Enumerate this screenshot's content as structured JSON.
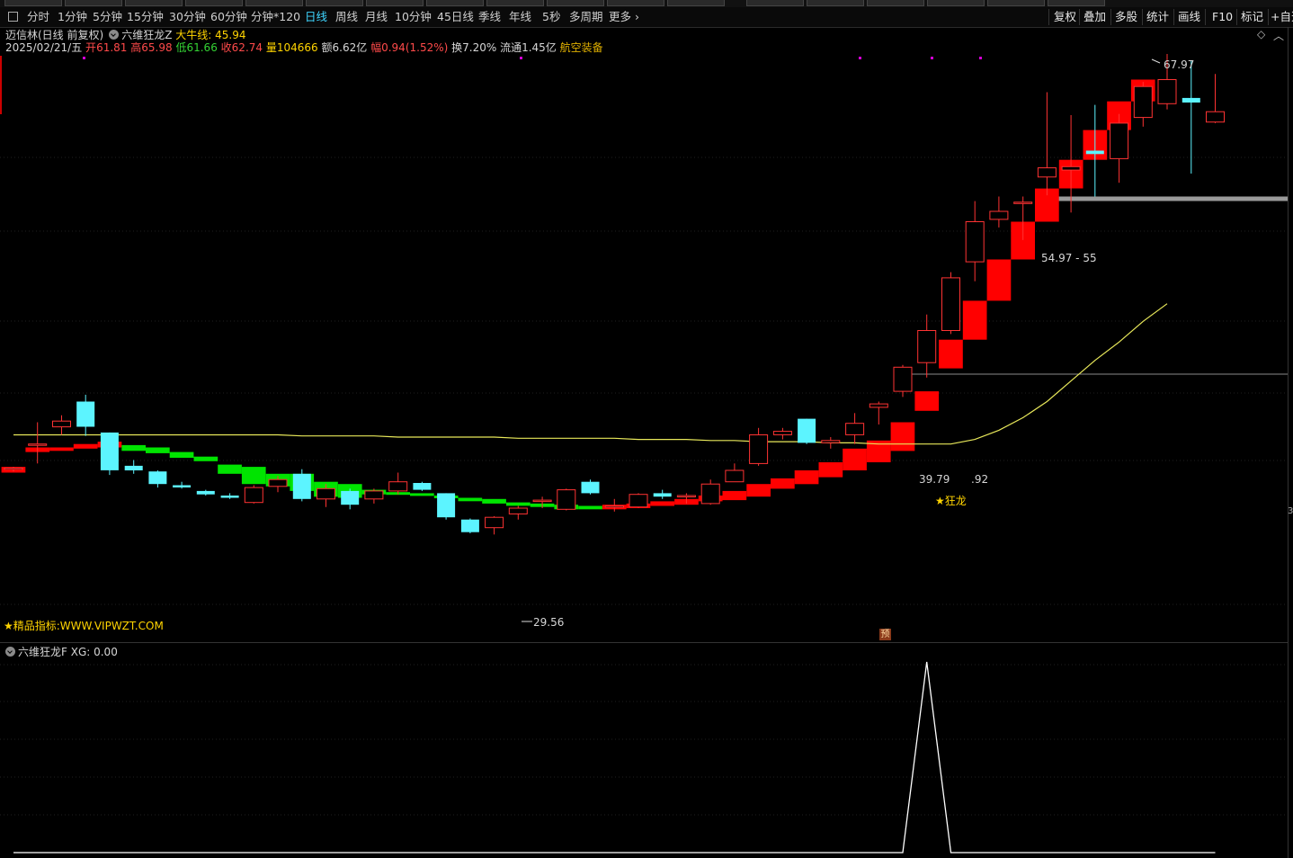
{
  "toolbar": {
    "periods": [
      "分时",
      "1分钟",
      "5分钟",
      "15分钟",
      "30分钟",
      "60分钟",
      "分钟*120",
      "日线",
      "周线",
      "月线",
      "10分钟",
      "45日线",
      "季线",
      "年线",
      "5秒",
      "多周期",
      "更多"
    ],
    "active_period": "日线",
    "right_buttons": [
      "复权",
      "叠加",
      "多股",
      "统计",
      "画线",
      "F10",
      "标记",
      "+自选"
    ]
  },
  "header": {
    "stock": "迈信林(日线 前复权)",
    "indicator_name": "六维狂龙Z",
    "indicator_value": "大牛线: 45.94",
    "date": "2025/02/21/五",
    "open_label": "开",
    "open": "61.81",
    "high_label": "高",
    "high": "65.98",
    "low_label": "低",
    "low": "61.66",
    "close_label": "收",
    "close": "62.74",
    "vol_label": "量",
    "vol": "104666",
    "amount": "额6.62亿",
    "chg_label": "幅",
    "chg": "0.94(1.52%)",
    "turnover": "换7.20%",
    "float": "流通1.45亿",
    "sector": "航空装备"
  },
  "chart_labels": {
    "high_mark": "67.97",
    "low_mark": "29.56",
    "range_label": "54.97 - 55",
    "mid_label_left": "39.79",
    "mid_label_right": ".92",
    "signal": "★狂龙",
    "watermark": "★精品指标:WWW.VIPWZT.COM",
    "pre_badge": "预",
    "right_axis_num": "3"
  },
  "sub_panel": {
    "title": "六维狂龙F",
    "value": "XG: 0.00"
  },
  "colors": {
    "up": "#ff3333",
    "down": "#5cf4ff",
    "ribbon_up": "#ff0000",
    "ribbon_down": "#00e400",
    "ma": "#e8e85a"
  },
  "chart_data": {
    "type": "candlestick",
    "ohlc": [
      [
        31.6,
        31.7,
        31.3,
        31.6
      ],
      [
        33.6,
        35.6,
        32.0,
        33.7
      ],
      [
        35.2,
        36.2,
        34.5,
        35.7
      ],
      [
        37.4,
        38.0,
        34.4,
        35.2
      ],
      [
        34.7,
        34.7,
        31.0,
        31.4
      ],
      [
        31.8,
        32.3,
        31.1,
        31.4
      ],
      [
        31.3,
        31.4,
        29.9,
        30.2
      ],
      [
        30.1,
        30.4,
        29.8,
        29.9
      ],
      [
        29.6,
        29.7,
        29.2,
        29.3
      ],
      [
        29.2,
        29.4,
        28.9,
        29.0
      ],
      [
        28.6,
        30.1,
        28.5,
        29.9
      ],
      [
        30.0,
        30.9,
        29.5,
        30.6
      ],
      [
        31.1,
        31.5,
        28.7,
        28.9
      ],
      [
        28.9,
        30.2,
        28.2,
        29.8
      ],
      [
        29.6,
        29.8,
        28.0,
        28.4
      ],
      [
        28.9,
        29.8,
        28.5,
        29.6
      ],
      [
        29.6,
        31.2,
        29.3,
        30.4
      ],
      [
        30.3,
        30.4,
        29.6,
        29.7
      ],
      [
        29.4,
        29.4,
        27.1,
        27.3
      ],
      [
        27.1,
        27.2,
        25.9,
        26.0
      ],
      [
        26.4,
        27.4,
        25.8,
        27.3
      ],
      [
        27.6,
        28.3,
        27.1,
        28.1
      ],
      [
        28.7,
        29.1,
        28.1,
        28.8
      ],
      [
        28.0,
        29.8,
        27.9,
        29.7
      ],
      [
        30.4,
        30.6,
        29.3,
        29.4
      ],
      [
        28.2,
        28.9,
        27.8,
        28.3
      ],
      [
        28.2,
        29.4,
        28.1,
        29.3
      ],
      [
        29.4,
        29.7,
        28.9,
        29.1
      ],
      [
        29.1,
        29.4,
        28.5,
        29.2
      ],
      [
        28.5,
        30.6,
        28.4,
        30.2
      ],
      [
        30.4,
        32.0,
        30.4,
        31.4
      ],
      [
        32.0,
        35.1,
        31.8,
        34.5
      ],
      [
        34.5,
        35.1,
        34.1,
        34.8
      ],
      [
        35.9,
        35.9,
        33.7,
        33.8
      ],
      [
        33.8,
        34.3,
        33.3,
        34.0
      ],
      [
        34.5,
        36.4,
        33.7,
        35.5
      ],
      [
        36.9,
        37.4,
        35.4,
        37.2
      ],
      [
        38.3,
        40.6,
        37.8,
        40.4
      ],
      [
        40.8,
        45.0,
        39.5,
        43.6
      ],
      [
        43.6,
        48.7,
        43.3,
        48.2
      ],
      [
        49.6,
        54.9,
        47.9,
        53.1
      ],
      [
        53.3,
        55.3,
        52.6,
        54.0
      ],
      [
        54.7,
        55.3,
        51.5,
        54.8
      ],
      [
        57.0,
        64.4,
        55.4,
        57.8
      ],
      [
        57.6,
        62.4,
        53.9,
        57.9
      ],
      [
        59.3,
        63.3,
        55.3,
        59.0
      ],
      [
        58.6,
        62.5,
        56.5,
        61.7
      ],
      [
        62.2,
        65.3,
        61.4,
        64.9
      ],
      [
        63.4,
        67.9,
        62.9,
        65.5
      ],
      [
        63.9,
        67.2,
        57.3,
        63.5
      ],
      [
        61.8,
        66.0,
        61.7,
        62.7
      ]
    ],
    "ma": [
      34.5,
      34.5,
      34.5,
      34.5,
      34.5,
      34.5,
      34.5,
      34.5,
      34.5,
      34.5,
      34.5,
      34.5,
      34.4,
      34.4,
      34.4,
      34.4,
      34.3,
      34.3,
      34.3,
      34.3,
      34.3,
      34.2,
      34.2,
      34.2,
      34.2,
      34.2,
      34.1,
      34.1,
      34.1,
      34.0,
      34.0,
      33.9,
      33.9,
      33.9,
      33.8,
      33.8,
      33.7,
      33.7,
      33.7,
      33.7,
      34.1,
      34.9,
      36.0,
      37.4,
      39.2,
      41.0,
      42.6,
      44.4,
      45.94
    ],
    "ribbon": [
      [
        31.7,
        31.2
      ],
      [
        33.4,
        33.0
      ],
      [
        33.4,
        33.1
      ],
      [
        33.7,
        33.3
      ],
      [
        33.9,
        33.4
      ],
      [
        33.6,
        33.1
      ],
      [
        33.4,
        32.9
      ],
      [
        33.0,
        32.5
      ],
      [
        32.6,
        32.2
      ],
      [
        31.9,
        31.1
      ],
      [
        31.7,
        30.2
      ],
      [
        31.1,
        30.0
      ],
      [
        31.1,
        29.6
      ],
      [
        30.4,
        29.1
      ],
      [
        30.2,
        29.0
      ],
      [
        29.7,
        29.3
      ],
      [
        29.5,
        29.3
      ],
      [
        29.4,
        29.2
      ],
      [
        29.2,
        29.0
      ],
      [
        29.0,
        28.7
      ],
      [
        28.9,
        28.5
      ],
      [
        28.6,
        28.3
      ],
      [
        28.5,
        28.2
      ],
      [
        28.4,
        28.0
      ],
      [
        28.3,
        28.0
      ],
      [
        28.4,
        28.0
      ],
      [
        28.5,
        28.1
      ],
      [
        28.7,
        28.3
      ],
      [
        28.9,
        28.4
      ],
      [
        29.2,
        28.7
      ],
      [
        29.6,
        28.8
      ],
      [
        30.2,
        29.1
      ],
      [
        30.7,
        29.8
      ],
      [
        31.4,
        30.2
      ],
      [
        32.1,
        30.8
      ],
      [
        33.3,
        31.4
      ],
      [
        34.0,
        32.1
      ],
      [
        35.6,
        33.1
      ],
      [
        38.3,
        36.6
      ],
      [
        42.8,
        40.3
      ],
      [
        46.2,
        42.8
      ],
      [
        49.8,
        46.2
      ],
      [
        53.1,
        49.8
      ],
      [
        56.0,
        53.1
      ],
      [
        58.5,
        56.0
      ],
      [
        61.1,
        58.5
      ],
      [
        63.6,
        61.1
      ],
      [
        65.5,
        63.6
      ]
    ],
    "sub_signal_index": 38
  }
}
